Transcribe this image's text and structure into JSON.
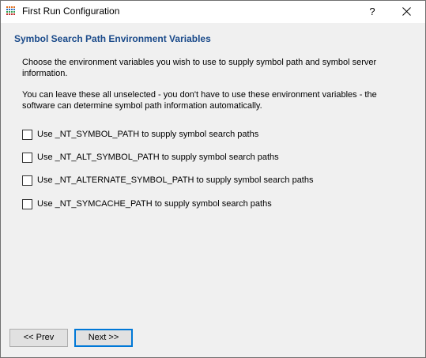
{
  "window": {
    "title": "First Run Configuration",
    "help_label": "?"
  },
  "page": {
    "heading": "Symbol Search Path Environment Variables",
    "intro": "Choose the environment variables you wish to use to supply symbol path and symbol server information.",
    "note": "You can leave these all unselected - you don't have to use these environment variables - the software can determine symbol path information automatically."
  },
  "options": [
    {
      "label": "Use _NT_SYMBOL_PATH to supply symbol search paths",
      "checked": false
    },
    {
      "label": "Use _NT_ALT_SYMBOL_PATH to supply symbol search paths",
      "checked": false
    },
    {
      "label": "Use _NT_ALTERNATE_SYMBOL_PATH to supply symbol search paths",
      "checked": false
    },
    {
      "label": "Use _NT_SYMCACHE_PATH to supply symbol search paths",
      "checked": false
    }
  ],
  "buttons": {
    "prev_label": "<< Prev",
    "next_label": "Next >>"
  },
  "colors": {
    "heading": "#1a4a8a",
    "accent": "#0078d7"
  },
  "icons": {
    "app": "grid-app-icon",
    "close": "close-icon"
  }
}
